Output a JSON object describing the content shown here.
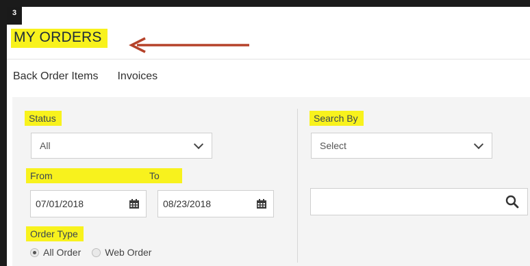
{
  "step_badge": "3",
  "page_title": "MY ORDERS",
  "subnav": [
    "Back Order Items",
    "Invoices"
  ],
  "filters": {
    "status_label": "Status",
    "status_value": "All",
    "from_label": "From",
    "to_label": "To",
    "from_date": "07/01/2018",
    "to_date": "08/23/2018",
    "order_type_label": "Order Type",
    "order_types": [
      {
        "label": "All Order",
        "selected": true
      },
      {
        "label": "Web Order",
        "selected": false
      }
    ],
    "search_by_label": "Search By",
    "search_by_value": "Select",
    "search_value": ""
  },
  "colors": {
    "highlight": "#f8f21d",
    "arrow": "#b5422a",
    "panel": "#f4f4f4"
  },
  "icons": [
    "chevron-down-icon",
    "calendar-icon",
    "search-icon",
    "arrow-left-icon"
  ]
}
